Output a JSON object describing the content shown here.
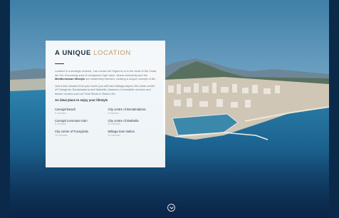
{
  "section": {
    "title_main": "A UNIQUE",
    "title_accent": "LOCATION",
    "paragraph1": {
      "before": "Located in a strategic enclave, Las Lomas del Higuerón is in the heart of the Costa del Sol. A booming area of recognized high value, where exclusivity and the ",
      "bold": "Mediterranean lifestyle",
      "after": " are masterfully blended, creating a unique concept of life."
    },
    "paragraph2": "Just a few minutes from your home you will have Malaga airport, the urban center of Fuengirola, Benalmádena and Marbella, beaches of incredible richness and leisure centers such as Tivoli World or Selwo Life.",
    "lead": "An ideal place to enjoy your lifestyle",
    "places": [
      {
        "name": "Carvajal Beach",
        "time": "5 minutes"
      },
      {
        "name": "City centre of Benalmádena",
        "time": "5 minutes"
      },
      {
        "name": "Carvajal commuter train",
        "time": "5 minutes"
      },
      {
        "name": "City centre of Marbella",
        "time": "20 minutes"
      },
      {
        "name": "City centre of Fuengirola",
        "time": "10 minutes"
      },
      {
        "name": "Málaga train station",
        "time": "20 minutes"
      }
    ]
  },
  "icons": {
    "scroll": "chevron-down-icon"
  }
}
